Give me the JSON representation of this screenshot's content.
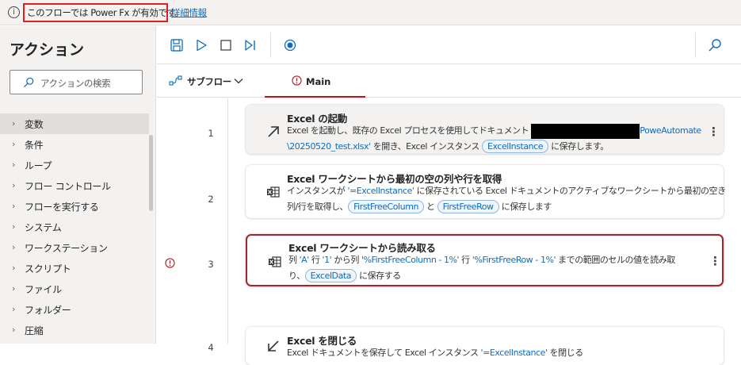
{
  "banner": {
    "message": "このフローでは Power Fx が有効です。",
    "link": "詳細情報"
  },
  "sidebar": {
    "title": "アクション",
    "search_placeholder": "アクションの検索",
    "items": [
      "変数",
      "条件",
      "ループ",
      "フロー コントロール",
      "フローを実行する",
      "システム",
      "ワークステーション",
      "スクリプト",
      "ファイル",
      "フォルダー",
      "圧縮"
    ]
  },
  "tabs": {
    "subflow": "サブフロー",
    "main": "Main"
  },
  "steps": [
    {
      "num": "1",
      "title": "Excel の起動",
      "line1_a": "Excel を起動し、既存の Excel プロセスを使用してドキュメント ",
      "line1_b": "PoweAutomate",
      "line2_a": "\\20250520_test.xlsx'",
      "line2_b": " を開き、Excel インスタンス ",
      "var1": "ExcelInstance",
      "line2_c": " に保存します。"
    },
    {
      "num": "2",
      "title": "Excel ワークシートから最初の空の列や行を取得",
      "line1_a": "インスタンスが ",
      "line1_b": "'=ExcelInstance'",
      "line1_c": " に保存されている Excel ドキュメントのアクティブなワークシートから最初の空き",
      "line2_a": "列/行を取得し、",
      "var1": "FirstFreeColumn",
      "line2_b": " と ",
      "var2": "FirstFreeRow",
      "line2_c": " に保存します"
    },
    {
      "num": "3",
      "title": "Excel ワークシートから読み取る",
      "line1_a": "列 ",
      "line1_b": "'A'",
      "line1_c": " 行 ",
      "line1_d": "'1'",
      "line1_e": " から列 ",
      "line1_f": "'%FirstFreeColumn - 1%'",
      "line1_g": " 行 ",
      "line1_h": "'%FirstFreeRow - 1%'",
      "line1_i": " までの範囲のセルの値を読み取",
      "line2_a": "り、",
      "var1": "ExcelData",
      "line2_b": " に保存する"
    },
    {
      "num": "4",
      "title": "Excel を閉じる",
      "line1_a": "Excel ドキュメントを保存して Excel インスタンス ",
      "line1_b": "'=ExcelInstance'",
      "line1_c": " を閉じる"
    }
  ],
  "more_glyph": "⋮",
  "colors": {
    "accent": "#0f6cbd",
    "error": "#a4262c",
    "banner_highlight": "#e02020"
  }
}
